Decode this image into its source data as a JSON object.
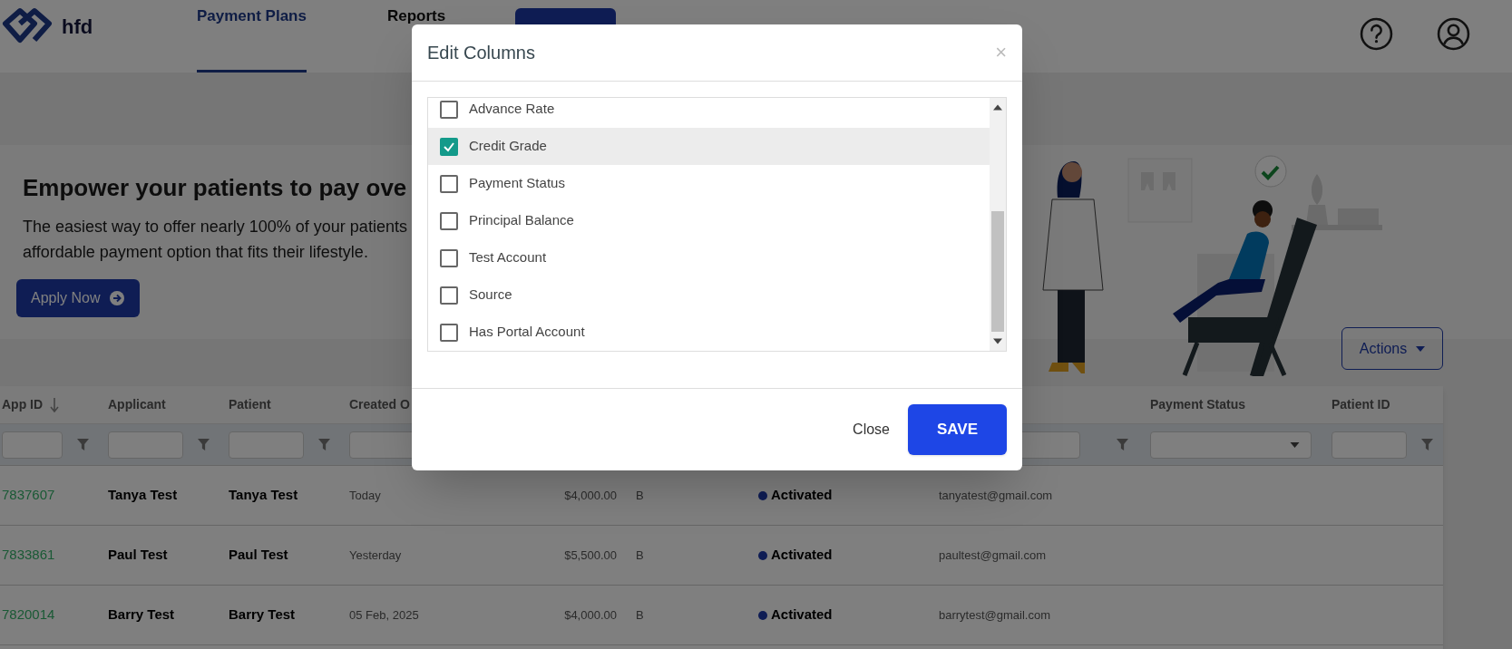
{
  "header": {
    "logo_text": "hfd",
    "nav": [
      {
        "label": "Payment Plans",
        "selected": true
      },
      {
        "label": "Reports",
        "selected": false
      }
    ]
  },
  "hero": {
    "heading": "Empower your patients to pay ove",
    "lines": [
      "The easiest way to offer nearly 100% of your patients",
      "affordable payment option that fits their lifestyle."
    ],
    "button": "Apply Now"
  },
  "actions_button": "Actions",
  "table": {
    "columns": [
      {
        "label": "App ID",
        "sorted": true,
        "kind": "text"
      },
      {
        "label": "Applicant",
        "sorted": false,
        "kind": "text"
      },
      {
        "label": "Patient",
        "sorted": false,
        "kind": "text"
      },
      {
        "label": "Created O",
        "sorted": false,
        "kind": "text"
      },
      {
        "label": "Payment Status",
        "sorted": false,
        "kind": "select"
      },
      {
        "label": "Patient ID",
        "sorted": false,
        "kind": "text"
      }
    ],
    "rows": [
      {
        "app_id": "7837607",
        "applicant": "Tanya Test",
        "patient": "Tanya Test",
        "created": "Today",
        "amount": "$4,000.00",
        "grade": "B",
        "status": "Activated",
        "email": "tanyatest@gmail.com"
      },
      {
        "app_id": "7833861",
        "applicant": "Paul Test",
        "patient": "Paul Test",
        "created": "Yesterday",
        "amount": "$5,500.00",
        "grade": "B",
        "status": "Activated",
        "email": "paultest@gmail.com"
      },
      {
        "app_id": "7820014",
        "applicant": "Barry Test",
        "patient": "Barry Test",
        "created": "05 Feb, 2025",
        "amount": "$4,000.00",
        "grade": "B",
        "status": "Activated",
        "email": "barrytest@gmail.com"
      }
    ]
  },
  "modal": {
    "title": "Edit Columns",
    "close_glyph": "×",
    "options": [
      {
        "label": "Advance Rate",
        "checked": false,
        "selected": false
      },
      {
        "label": "Credit Grade",
        "checked": true,
        "selected": true
      },
      {
        "label": "Payment Status",
        "checked": false,
        "selected": false
      },
      {
        "label": "Principal Balance",
        "checked": false,
        "selected": false
      },
      {
        "label": "Test Account",
        "checked": false,
        "selected": false
      },
      {
        "label": "Source",
        "checked": false,
        "selected": false
      },
      {
        "label": "Has Portal Account",
        "checked": false,
        "selected": false
      }
    ],
    "close_button": "Close",
    "save_button": "SAVE"
  }
}
